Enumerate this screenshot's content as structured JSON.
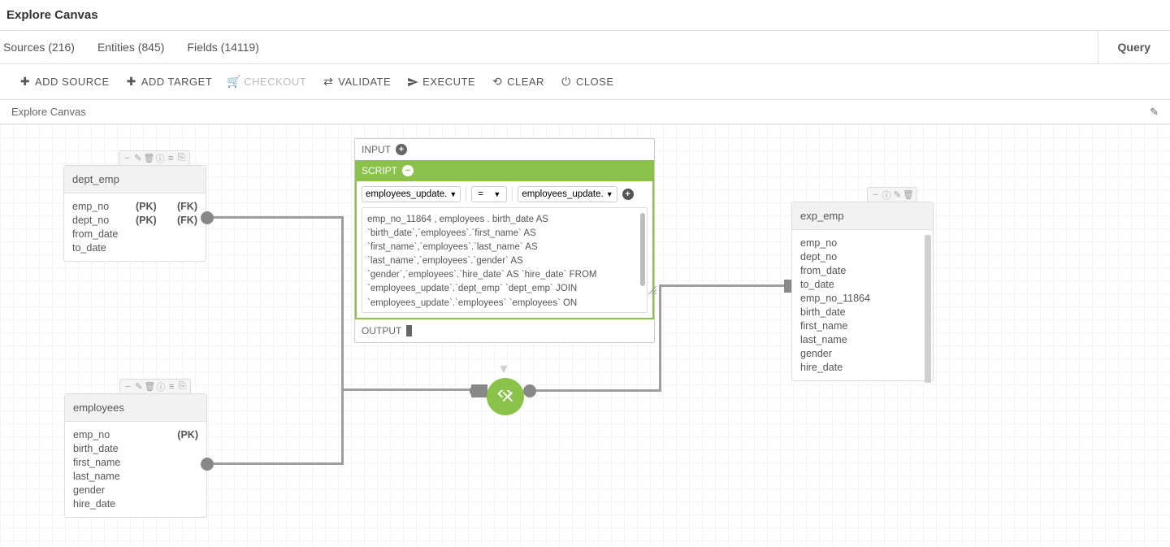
{
  "page_title": "Explore Canvas",
  "tabs": {
    "sources": "Sources (216)",
    "entities": "Entities (845)",
    "fields": "Fields (14119)",
    "query": "Query"
  },
  "toolbar": {
    "add_source": "ADD SOURCE",
    "add_target": "ADD TARGET",
    "checkout": "CHECKOUT",
    "validate": "VALIDATE",
    "execute": "EXECUTE",
    "clear": "CLEAR",
    "close": "CLOSE"
  },
  "breadcrumb": "Explore Canvas",
  "node_dept_emp": {
    "title": "dept_emp",
    "fields": [
      {
        "name": "emp_no",
        "pk": "(PK)",
        "fk": "(FK)"
      },
      {
        "name": "dept_no",
        "pk": "(PK)",
        "fk": "(FK)"
      },
      {
        "name": "from_date",
        "pk": "",
        "fk": ""
      },
      {
        "name": "to_date",
        "pk": "",
        "fk": ""
      }
    ]
  },
  "node_employees": {
    "title": "employees",
    "fields": [
      {
        "name": "emp_no",
        "pk": "",
        "fk": "(PK)"
      },
      {
        "name": "birth_date",
        "pk": "",
        "fk": ""
      },
      {
        "name": "first_name",
        "pk": "",
        "fk": ""
      },
      {
        "name": "last_name",
        "pk": "",
        "fk": ""
      },
      {
        "name": "gender",
        "pk": "",
        "fk": ""
      },
      {
        "name": "hire_date",
        "pk": "",
        "fk": ""
      }
    ]
  },
  "script_node": {
    "input_label": "INPUT",
    "script_label": "SCRIPT",
    "output_label": "OUTPUT",
    "select_left": "employees_update.",
    "select_op": "=",
    "select_right": "employees_update.",
    "sql_text": "emp_no_11864 , employees . birth_date AS `birth_date`,`employees`.`first_name` AS `first_name`,`employees`.`last_name` AS `last_name`,`employees`.`gender` AS `gender`,`employees`.`hire_date` AS `hire_date` FROM `employees_update`.`dept_emp` `dept_emp` JOIN `employees_update`.`employees` `employees` ON (`dept_emp`.`emp_no`=`employees`.`emp_no`)"
  },
  "node_exp_emp": {
    "title": "exp_emp",
    "fields": [
      "emp_no",
      "dept_no",
      "from_date",
      "to_date",
      "emp_no_11864",
      "birth_date",
      "first_name",
      "last_name",
      "gender",
      "hire_date"
    ]
  }
}
